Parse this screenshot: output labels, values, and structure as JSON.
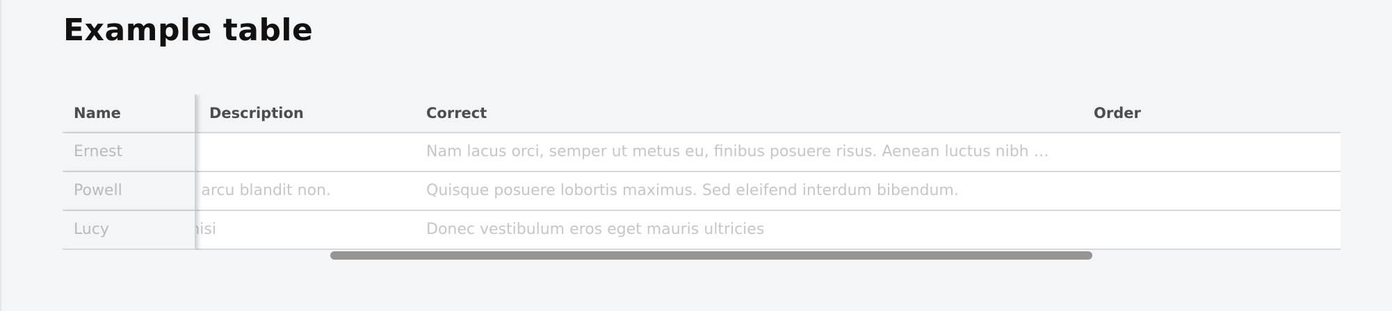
{
  "page": {
    "title": "Example table"
  },
  "table": {
    "columns": [
      "Name",
      "Description",
      "Correct",
      "Order"
    ],
    "rows": [
      {
        "name": "Ernest",
        "description": "",
        "correct": "Nam lacus orci, semper ut metus eu, finibus posuere risus. Aenean luctus nibh …",
        "order": ""
      },
      {
        "name": "Powell",
        "description": "tum arcu blandit non.",
        "correct": "Quisque posuere lobortis maximus. Sed eleifend interdum bibendum.",
        "order": ""
      },
      {
        "name": "Lucy",
        "description": "nisi",
        "correct": "Donec vestibulum eros eget mauris ultricies",
        "order": ""
      }
    ],
    "horizontal_scroll_fraction": 0.2
  },
  "colors": {
    "page_background": "#f4f5f7",
    "row_background": "#ffffff",
    "header_text": "#4a4d52",
    "cell_text": "#c3c6cc",
    "scrollbar_thumb": "#959595"
  }
}
